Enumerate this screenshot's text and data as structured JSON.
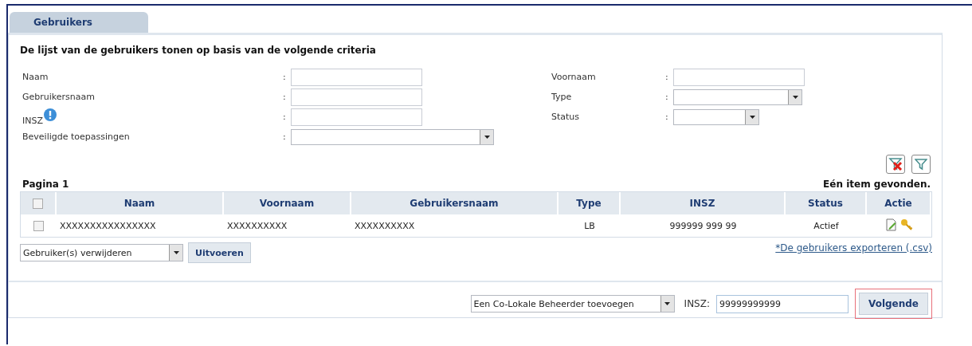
{
  "tabs": [
    {
      "label": "Gebruikers",
      "selected": true
    }
  ],
  "criteria": {
    "title": "De lijst van de gebruikers tonen op basis van de volgende criteria",
    "left_fields": [
      {
        "label": "Naam",
        "separator": ":",
        "kind": "text",
        "info": false
      },
      {
        "label": "Gebruikersnaam",
        "separator": ":",
        "kind": "text",
        "info": false
      },
      {
        "label": "INSZ",
        "separator": ":",
        "kind": "text",
        "info": true
      },
      {
        "label": "Beveiligde toepassingen",
        "separator": ":",
        "kind": "select",
        "info": false
      }
    ],
    "right_fields": [
      {
        "label": "Voornaam",
        "separator": ":",
        "kind": "text",
        "info": false
      },
      {
        "label": "Type",
        "separator": ":",
        "kind": "select",
        "info": false
      },
      {
        "label": "Status",
        "separator": ":",
        "kind": "select",
        "info": false
      }
    ]
  },
  "table": {
    "page_label": "Pagina 1",
    "result_count": "Eén item gevonden.",
    "header_checkbox": {
      "checked": false
    },
    "columns": [
      "Naam",
      "Voornaam",
      "Gebruikersnaam",
      "Type",
      "INSZ",
      "Status",
      "Actie"
    ],
    "rows": [
      {
        "checked": false,
        "cells": [
          "XXXXXXXXXXXXXXXX",
          "XXXXXXXXXX",
          "XXXXXXXXXX",
          "LB",
          "999999 999 99",
          "Actief"
        ]
      }
    ]
  },
  "bulk_action": {
    "value": "Gebruiker(s) verwijderen",
    "button": "Uitvoeren"
  },
  "export_link": "*De gebruikers exporteren (.csv)",
  "add_bar": {
    "action": "Een Co-Lokale Beheerder toevoegen",
    "insz_label": "INSZ:",
    "insz_value": "99999999999",
    "button": "Volgende",
    "button_highlighted": true
  }
}
